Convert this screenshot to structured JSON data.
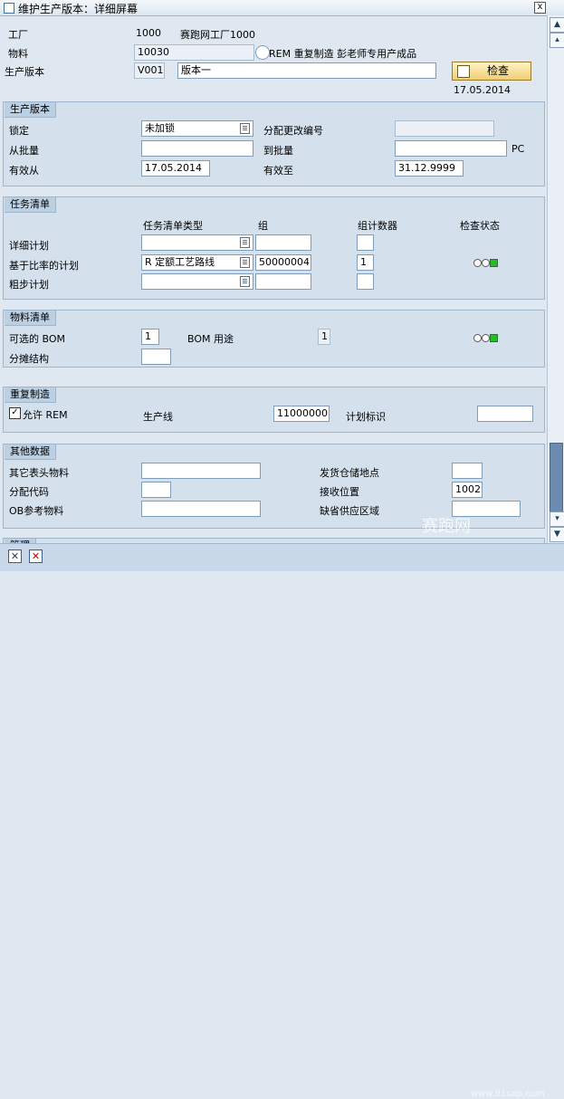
{
  "window": {
    "title": "维护生产版本：详细屏幕",
    "close_label": "x"
  },
  "header": {
    "plant_label": "工厂",
    "plant_value": "1000",
    "plant_desc": "赛跑网工厂1000",
    "material_label": "物料",
    "material_value": "10030",
    "material_desc": "REM 重复制造 彭老师专用产成品",
    "version_label": "生产版本",
    "version_value": "V001",
    "version_desc": "版本一",
    "check_button": "检查",
    "check_date": "17.05.2014"
  },
  "section_prodver": {
    "title": "生产版本",
    "lock_label": "锁定",
    "lock_value": "未加锁",
    "change_no_label": "分配更改编号",
    "change_no_value": "",
    "from_lot_label": "从批量",
    "from_lot_value": "",
    "to_lot_label": "到批量",
    "to_lot_value": "",
    "unit": "PC",
    "valid_from_label": "有效从",
    "valid_from_value": "17.05.2014",
    "valid_to_label": "有效至",
    "valid_to_value": "31.12.9999"
  },
  "section_tasklist": {
    "title": "任务清单",
    "col_type": "任务清单类型",
    "col_group": "组",
    "col_counter": "组计数器",
    "col_check": "检查状态",
    "rows": [
      {
        "label": "详细计划",
        "type": "",
        "group": "",
        "counter": ""
      },
      {
        "label": "基于比率的计划",
        "type": "R 定额工艺路线",
        "group": "50000004",
        "counter": "1"
      },
      {
        "label": "粗步计划",
        "type": "",
        "group": "",
        "counter": ""
      }
    ]
  },
  "section_bom": {
    "title": "物料清单",
    "alt_bom_label": "可选的 BOM",
    "alt_bom_value": "1",
    "bom_usage_label": "BOM 用途",
    "bom_usage_value": "1",
    "apportion_label": "分摊结构",
    "apportion_value": ""
  },
  "section_rem": {
    "title": "重复制造",
    "allow_rem_label": "允许 REM",
    "allow_rem_checked": true,
    "line_label": "生产线",
    "line_value": "11000000",
    "plan_id_label": "计划标识",
    "plan_id_value": ""
  },
  "section_other": {
    "title": "其他数据",
    "other_header_label": "其它表头物料",
    "other_header_value": "",
    "issue_loc_label": "发货仓储地点",
    "issue_loc_value": "",
    "dist_key_label": "分配代码",
    "dist_key_value": "",
    "receive_loc_label": "接收位置",
    "receive_loc_value": "1002",
    "ob_ref_label": "OB参考物料",
    "ob_ref_value": "",
    "supply_area_label": "缺省供应区域",
    "supply_area_value": "",
    "next_section_partial": "管理"
  },
  "statusbar": {
    "watermark": "赛跑网",
    "watermark_url": "www.91sap.com"
  },
  "colors": {
    "green_light": "#22c022",
    "section_bg": "#d4e1ed",
    "button_gold": "#f0cf73"
  }
}
